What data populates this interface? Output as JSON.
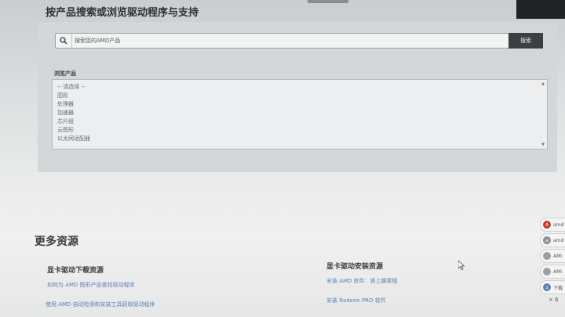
{
  "header": {
    "title": "按产品搜索或浏览驱动程序与支持"
  },
  "search": {
    "placeholder": "搜索您的AMD产品",
    "button_label": "搜索",
    "icon": "search-icon"
  },
  "browse": {
    "label": "浏览产品",
    "options": [
      "-- 请选择 --",
      "图形",
      "处理器",
      "加速器",
      "芯片组",
      "云图形",
      "以太网适配器"
    ]
  },
  "more_resources": {
    "title": "更多资源",
    "left_column": {
      "title": "显卡驱动下载资源",
      "links": [
        "如何为 AMD 图形产品查找驱动程序",
        "使用 AMD 自动检测和安装工具获取驱动程序"
      ]
    },
    "right_column": {
      "title": "显卡驱动安装资源",
      "links": [
        "安装 AMD 软件：肾上腺素版",
        "安装 Radeon PRO 软件"
      ]
    }
  },
  "side_widgets": [
    {
      "icon": "amd-red-icon",
      "text": "amd",
      "color": "#c8332b"
    },
    {
      "icon": "amd-gray-icon",
      "text": "amd",
      "color": "#8b8f94"
    },
    {
      "icon": "page-icon",
      "text": "AMI",
      "color": "#9aa0a5"
    },
    {
      "icon": "page-icon",
      "text": "AMI",
      "color": "#9aa0a5"
    },
    {
      "icon": "download-icon",
      "text": "下载",
      "color": "#5b83b0"
    }
  ],
  "side_misc_text": "× 6"
}
